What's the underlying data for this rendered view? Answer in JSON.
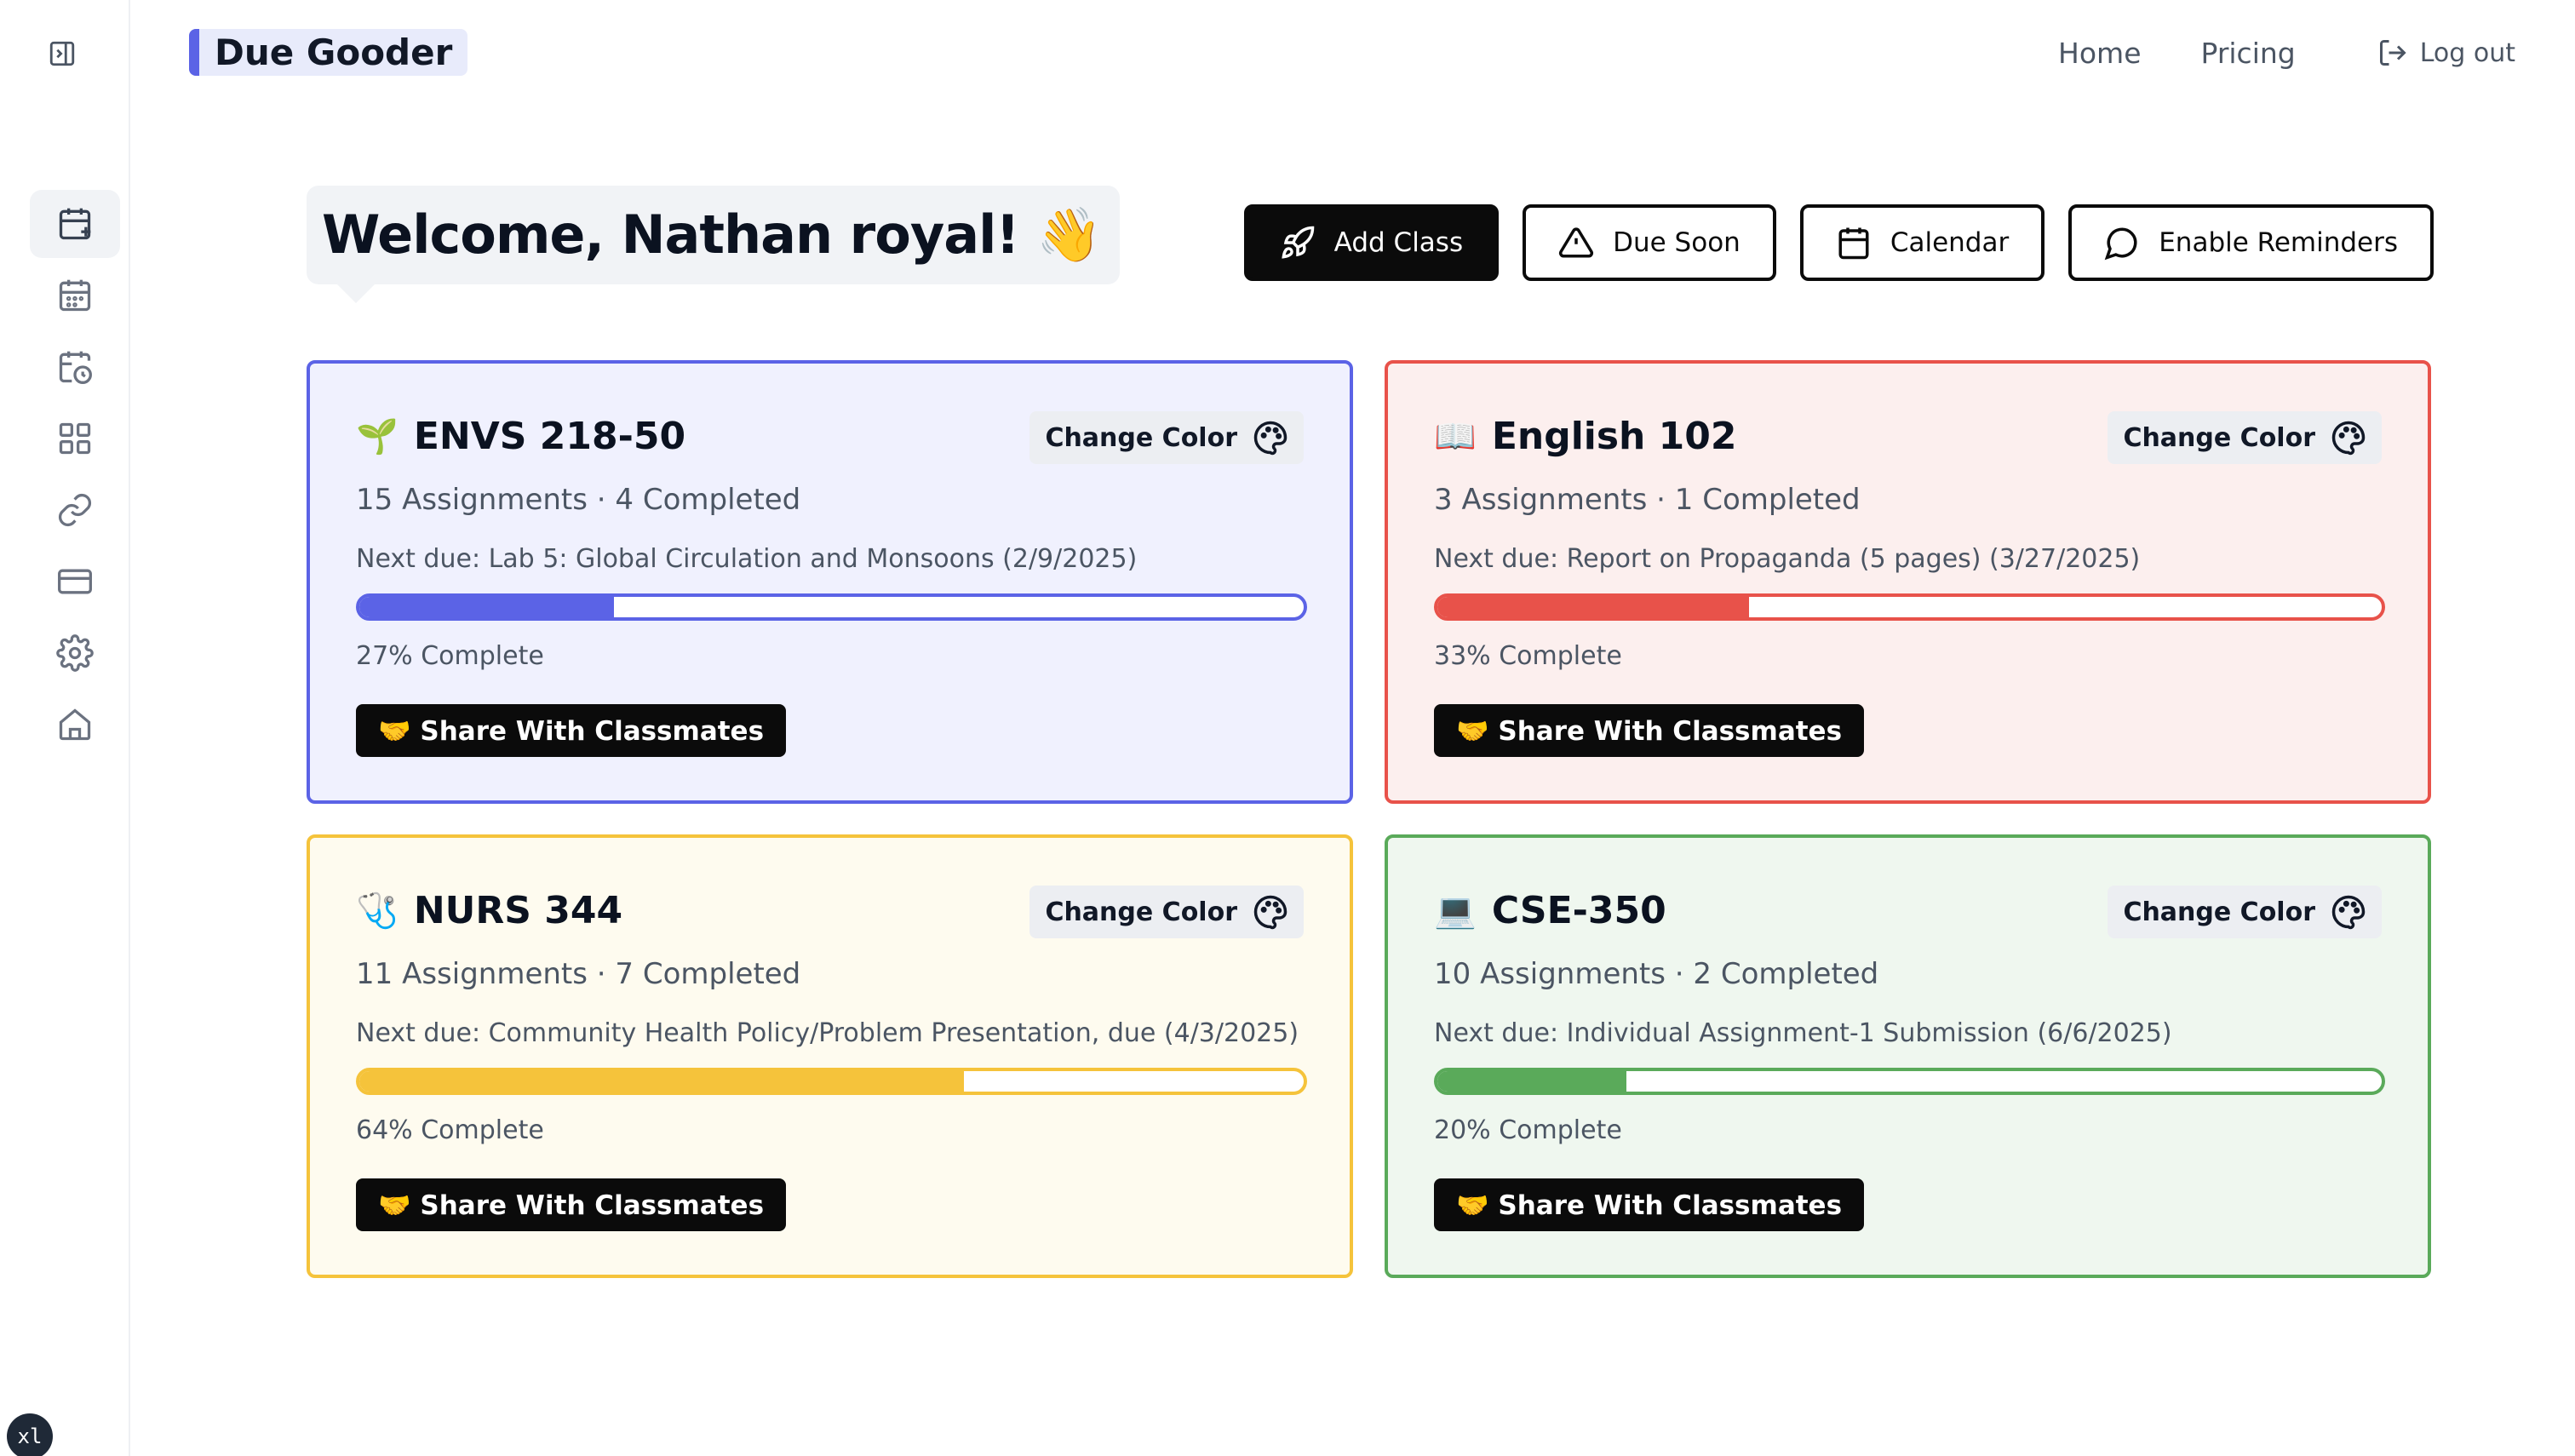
{
  "app": {
    "name": "Due Gooder"
  },
  "topnav": {
    "home": "Home",
    "pricing": "Pricing",
    "logout": "Log out"
  },
  "sidebar": {
    "items": [
      {
        "icon": "calendar-plus-icon",
        "active": true
      },
      {
        "icon": "calendar-icon",
        "active": false
      },
      {
        "icon": "calendar-clock-icon",
        "active": false
      },
      {
        "icon": "grid-icon",
        "active": false
      },
      {
        "icon": "link-icon",
        "active": false
      },
      {
        "icon": "credit-card-icon",
        "active": false
      },
      {
        "icon": "settings-icon",
        "active": false
      },
      {
        "icon": "home-icon",
        "active": false
      }
    ],
    "badge": "xl"
  },
  "welcome": {
    "text": "Welcome, Nathan royal! 👋"
  },
  "actions": {
    "add_class": "Add Class",
    "due_soon": "Due Soon",
    "calendar": "Calendar",
    "enable_reminders": "Enable Reminders"
  },
  "classes": [
    {
      "emoji": "🌱",
      "name": "ENVS 218-50",
      "counts": "15 Assignments · 4 Completed",
      "next_due": "Next due: Lab 5: Global Circulation and Monsoons (2/9/2025)",
      "progress": 27,
      "progress_label": "27% Complete",
      "change_color": "Change Color",
      "share": "🤝 Share With Classmates",
      "color": "#5b63e6",
      "bg": "#f0f1fe"
    },
    {
      "emoji": "📖",
      "name": "English 102",
      "counts": "3 Assignments · 1 Completed",
      "next_due": "Next due: Report on Propaganda (5 pages) (3/27/2025)",
      "progress": 33,
      "progress_label": "33% Complete",
      "change_color": "Change Color",
      "share": "🤝 Share With Classmates",
      "color": "#e8524a",
      "bg": "#fcefee"
    },
    {
      "emoji": "🩺",
      "name": "NURS 344",
      "counts": "11 Assignments · 7 Completed",
      "next_due": "Next due: Community Health Policy/Problem Presentation, due (4/3/2025)",
      "progress": 64,
      "progress_label": "64% Complete",
      "change_color": "Change Color",
      "share": "🤝 Share With Classmates",
      "color": "#f5c33b",
      "bg": "#fefbef"
    },
    {
      "emoji": "💻",
      "name": "CSE-350",
      "counts": "10 Assignments · 2 Completed",
      "next_due": "Next due: Individual Assignment-1 Submission (6/6/2025)",
      "progress": 20,
      "progress_label": "20% Complete",
      "change_color": "Change Color",
      "share": "🤝 Share With Classmates",
      "color": "#5aaa5a",
      "bg": "#eff7ef"
    }
  ]
}
